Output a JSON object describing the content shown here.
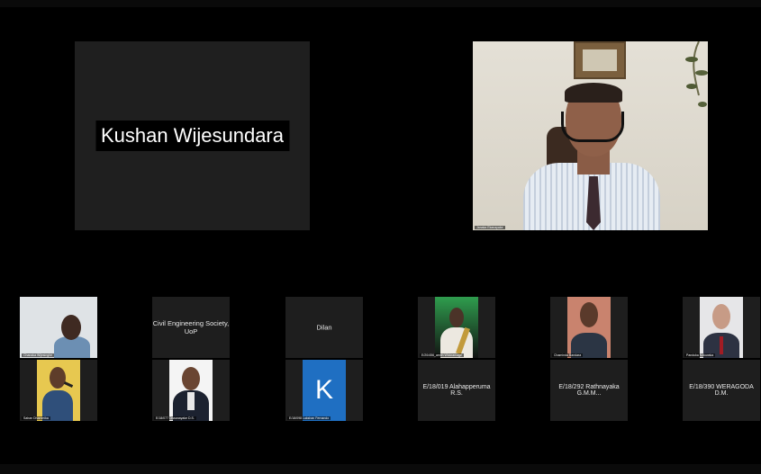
{
  "meeting": {
    "top_left_tile": {
      "name": "Kushan Wijesundara"
    },
    "top_right_tile": {
      "caption": "Janaka Ekanayake"
    },
    "grid": {
      "row1": [
        {
          "label": "Chanaka Wijesinghe",
          "type": "video"
        },
        {
          "label": "Civil Engineering Society, UoP",
          "type": "name"
        },
        {
          "label": "Dilan",
          "type": "name"
        },
        {
          "label": "E/20/456_amith Wickramage",
          "type": "video"
        },
        {
          "label": "Chaminda Bandara",
          "type": "video"
        },
        {
          "label": "Panduka Naluwaka",
          "type": "video"
        }
      ],
      "row2": [
        {
          "label": "Sahan Dhammika",
          "type": "video"
        },
        {
          "label": "E/18/077 Dissanayake D.S.",
          "type": "video"
        },
        {
          "label": "E/18/098 Lakshan Fernando",
          "type": "avatar",
          "initial": "K"
        },
        {
          "label": "E/18/019 Alahapperuma R.S.",
          "type": "name"
        },
        {
          "label": "E/18/292 Rathnayaka G.M.M...",
          "type": "name"
        },
        {
          "label": "E/18/390 WERAGODA D.M.",
          "type": "name"
        }
      ]
    }
  }
}
